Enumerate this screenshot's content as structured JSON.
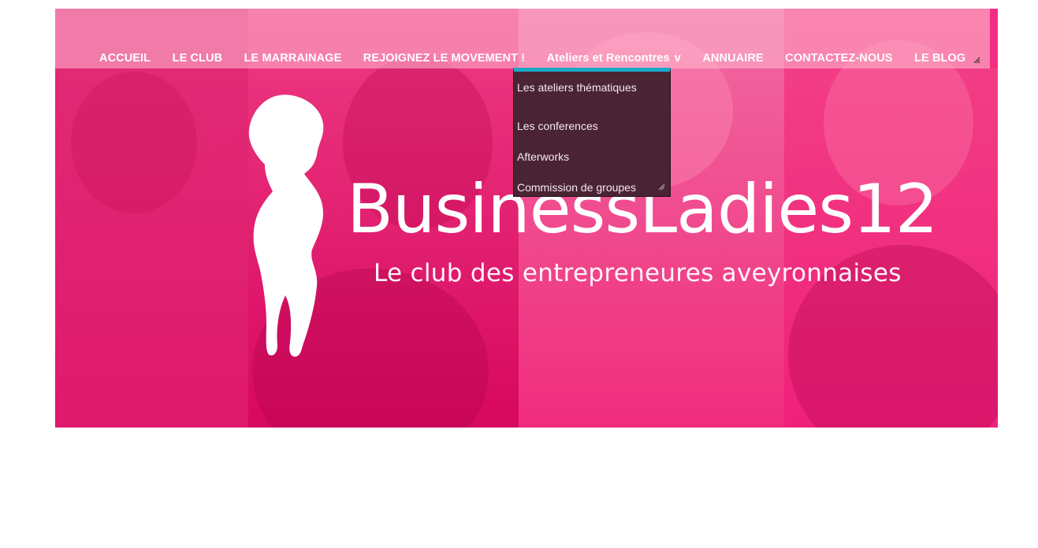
{
  "nav": {
    "items": [
      {
        "label": "ACCUEIL"
      },
      {
        "label": "LE CLUB"
      },
      {
        "label": "LE MARRAINAGE"
      },
      {
        "label": "REJOIGNEZ LE MOVEMENT !"
      },
      {
        "label": "Ateliers et Rencontres",
        "caret": "v"
      },
      {
        "label": "ANNUAIRE"
      },
      {
        "label": "CONTACTEZ-NOUS"
      },
      {
        "label": "LE BLOG"
      }
    ]
  },
  "dropdown": {
    "items": [
      {
        "label": "Les ateliers thématiques"
      },
      {
        "label": "Les conferences"
      },
      {
        "label": "Afterworks"
      },
      {
        "label": "Commission de groupes"
      }
    ]
  },
  "hero": {
    "logo_text": "BusinessLadies12",
    "tagline": "Le club des entrepreneures aveyronnaises"
  },
  "colors": {
    "hero_pink": "#f0247a",
    "dropdown_bg": "#4b2434",
    "dropdown_accent": "#19a8c8"
  }
}
